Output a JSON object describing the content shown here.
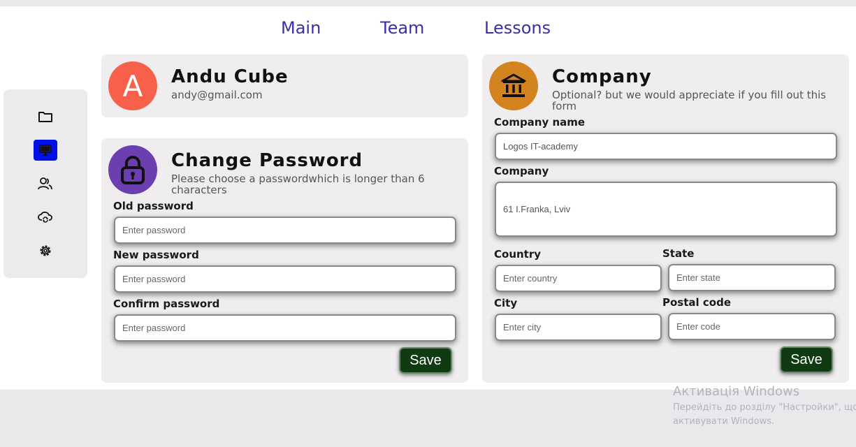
{
  "nav": {
    "main": "Main",
    "team": "Team",
    "lessons": "Lessons"
  },
  "sidebar": {
    "items": [
      {
        "icon": "folder-icon"
      },
      {
        "icon": "monitor-icon",
        "active": true
      },
      {
        "icon": "users-icon"
      },
      {
        "icon": "cloud-sync-icon"
      },
      {
        "icon": "gear-icon"
      }
    ]
  },
  "profile": {
    "initial": "A",
    "name": "Andu Cube",
    "email": "andy@gmail.com",
    "avatar_color": "#f7614c"
  },
  "password": {
    "title": "Change Password",
    "subtitle": "Please choose a passwordwhich is longer than 6 characters",
    "icon_color": "#6c3fb0",
    "old_label": "Old password",
    "old_placeholder": "Enter password",
    "new_label": "New password",
    "new_placeholder": "Enter password",
    "confirm_label": "Confirm password",
    "confirm_placeholder": "Enter password",
    "save_label": "Save"
  },
  "company": {
    "title": "Company",
    "subtitle": "Optional? but we would appreciate if you fill out this form",
    "icon_color": "#d4841e",
    "name_label": "Company name",
    "name_value": "Logos IT-academy",
    "address_label": "Company",
    "address_value": "61 I.Franka, Lviv",
    "country_label": "Country",
    "country_placeholder": "Enter country",
    "state_label": "State",
    "state_placeholder": "Enter state",
    "city_label": "City",
    "city_placeholder": "Enter city",
    "postal_label": "Postal code",
    "postal_placeholder": "Enter code",
    "save_label": "Save"
  },
  "watermark": {
    "title": "Активація Windows",
    "line1": "Перейдіть до розділу \"Настройки\", що",
    "line2": "активувати Windows."
  },
  "colors": {
    "accent": "#0010e6",
    "nav": "#3b2fa6",
    "save": "#0f3a12"
  }
}
